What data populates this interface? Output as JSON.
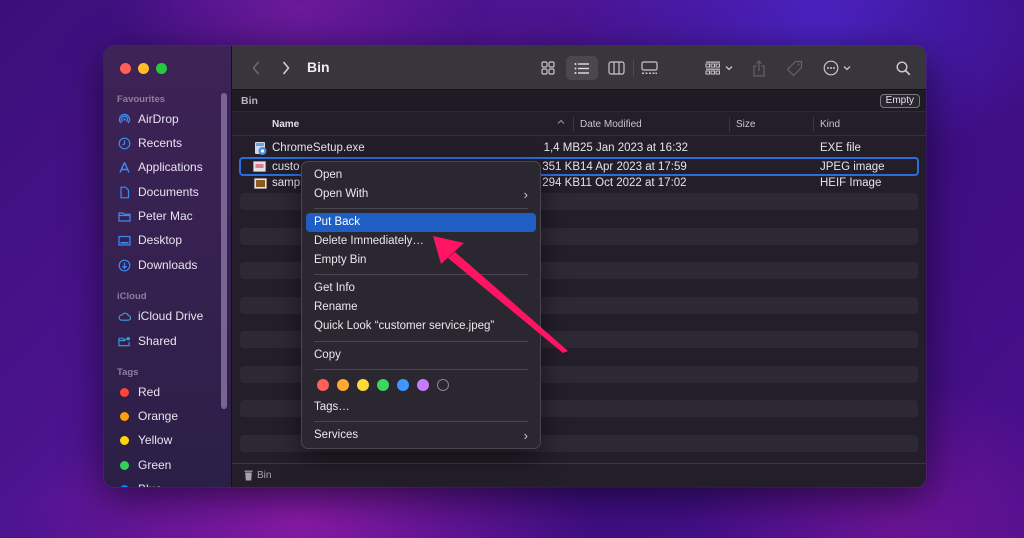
{
  "window": {
    "title": "Bin",
    "traffic_lights": [
      {
        "name": "close",
        "color": "#ff5f57"
      },
      {
        "name": "minimize",
        "color": "#febc2e"
      },
      {
        "name": "zoom",
        "color": "#28c840"
      }
    ]
  },
  "sidebar": {
    "favourites_label": "Favourites",
    "favourites": [
      {
        "label": "AirDrop",
        "icon": "airdrop-icon"
      },
      {
        "label": "Recents",
        "icon": "clock-icon"
      },
      {
        "label": "Applications",
        "icon": "applications-icon"
      },
      {
        "label": "Documents",
        "icon": "document-icon"
      },
      {
        "label": "Peter Mac",
        "icon": "folder-icon"
      },
      {
        "label": "Desktop",
        "icon": "desktop-icon"
      },
      {
        "label": "Downloads",
        "icon": "download-icon"
      }
    ],
    "icloud_label": "iCloud",
    "icloud": [
      {
        "label": "iCloud Drive",
        "icon": "cloud-icon"
      },
      {
        "label": "Shared",
        "icon": "shared-folder-icon"
      }
    ],
    "tags_label": "Tags",
    "tags": [
      {
        "label": "Red",
        "color": "#ff453a"
      },
      {
        "label": "Orange",
        "color": "#ff9f0a"
      },
      {
        "label": "Yellow",
        "color": "#ffd60a"
      },
      {
        "label": "Green",
        "color": "#30d158"
      },
      {
        "label": "Blue",
        "color": "#0a84ff"
      }
    ]
  },
  "toolbar": {
    "title": "Bin",
    "view_modes": [
      "icon-view",
      "list-view",
      "column-view",
      "gallery-view"
    ],
    "active_view": "list-view"
  },
  "pathbar": {
    "label": "Bin",
    "empty_button": "Empty"
  },
  "columns": {
    "name": "Name",
    "date": "Date Modified",
    "size": "Size",
    "kind": "Kind"
  },
  "files": [
    {
      "name": "ChromeSetup.exe",
      "date": "25 Jan 2023 at 16:32",
      "size": "1,4 MB",
      "kind": "EXE file",
      "selected": false
    },
    {
      "name": "custo",
      "date": "14 Apr 2023 at 17:59",
      "size": "351 KB",
      "kind": "JPEG image",
      "selected": true
    },
    {
      "name": "samp",
      "date": "11 Oct 2022 at 17:02",
      "size": "294 KB",
      "kind": "HEIF Image",
      "selected": false
    }
  ],
  "footer": {
    "label": "Bin"
  },
  "context_menu": {
    "items": [
      {
        "label": "Open"
      },
      {
        "label": "Open With",
        "submenu": true
      },
      {
        "label": "Put Back",
        "highlighted": true
      },
      {
        "label": "Delete Immediately…"
      },
      {
        "label": "Empty Bin"
      },
      {
        "label": "Get Info"
      },
      {
        "label": "Rename"
      },
      {
        "label": "Quick Look “customer service.jpeg”"
      },
      {
        "label": "Copy"
      },
      {
        "label": "Tags…"
      },
      {
        "label": "Services",
        "submenu": true
      }
    ],
    "submenu_glyph": "›",
    "tag_colors": [
      "#ff5f57",
      "#ffa933",
      "#ffd93a",
      "#3ed460",
      "#3d97ff",
      "#c67bff",
      "none"
    ]
  },
  "annotation": {
    "arrow_color": "#ff1464"
  }
}
